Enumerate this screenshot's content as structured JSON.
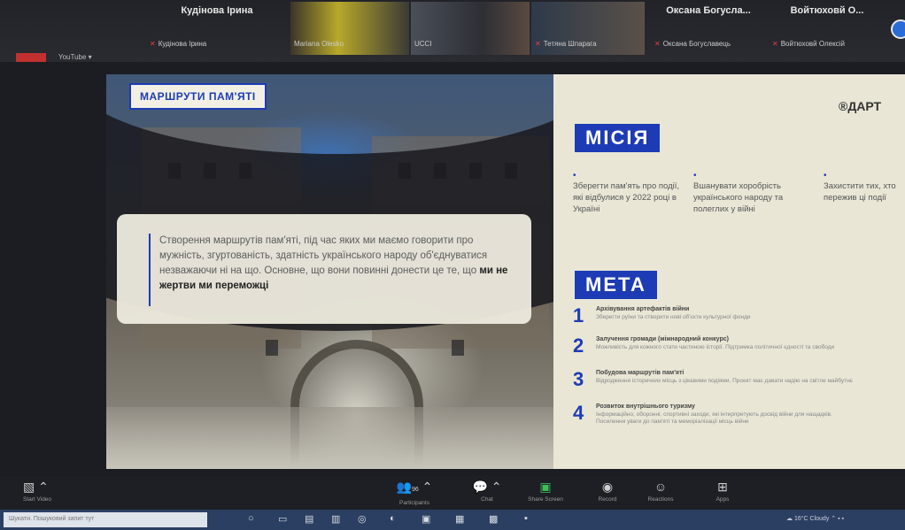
{
  "meeting": {
    "participants": [
      {
        "name": "Кудінова Ірина",
        "label": "Кудінова Ірина"
      },
      {
        "name": "",
        "label": "Mariana Olesko"
      },
      {
        "name": "",
        "label": "UCCI"
      },
      {
        "name": "",
        "label": "Тетяна Шпарага"
      },
      {
        "name": "Оксана Богусла...",
        "label": "Оксана Богуславець"
      },
      {
        "name": "Войтюховй О...",
        "label": "Войтюховй Олексій"
      }
    ],
    "youtube_label": "YouTube ▾"
  },
  "slide": {
    "title_badge": "МАРШРУТИ ПАМ'ЯТІ",
    "quote": {
      "text": "Створення маршрутів пам'яті, під час яких ми маємо говорити про мужність, згуртованість, здатність українського народу об'єднуватися незважаючи ні на що. Основне, що вони повинні донести це те, що ",
      "bold": "ми не жертви ми переможці"
    },
    "logo": "®ДАРТ",
    "mission": {
      "heading": "МІСІЯ",
      "items": [
        "Зберегти пам'ять про події, які відбулися у 2022 році в Україні",
        "Вшанувати хоробрість українського народу та полеглих у війні",
        "Захистити тих, хто пережив ці події"
      ]
    },
    "goal": {
      "heading": "МЕТА",
      "items": [
        {
          "num": "1",
          "title": "Архівування артефактів війни",
          "desc": "Зберегти руїни та створити нові об'єкти культурної фонди"
        },
        {
          "num": "2",
          "title": "Залучення громади (міжнародний конкурс)",
          "desc": "Можливість для кожного стати частиною історії. Підтримка політичної єдності та свободи"
        },
        {
          "num": "3",
          "title": "Побудова маршрутів пам'яті",
          "desc": "Відродження історичних місць з цікавими подіями. Проект має давати надію на світле майбутнє"
        },
        {
          "num": "4",
          "title": "Розвиток внутрішнього туризму",
          "desc": "Інформаційно, оборонні, спортивні заходи, які інтерпретують досвід війни для нащадків. Посилення уваги до пам'яті та меморіалізації місць війни"
        }
      ]
    }
  },
  "toolbar": {
    "start_video": "Start Video",
    "participants": "Participants",
    "participants_count": "96",
    "chat": "Chat",
    "share_screen": "Share Screen",
    "record": "Record",
    "reactions": "Reactions",
    "apps": "Apps"
  },
  "taskbar": {
    "search_placeholder": "Шукати. Пошуковий запит тут",
    "weather": "16°C Cloudy"
  }
}
